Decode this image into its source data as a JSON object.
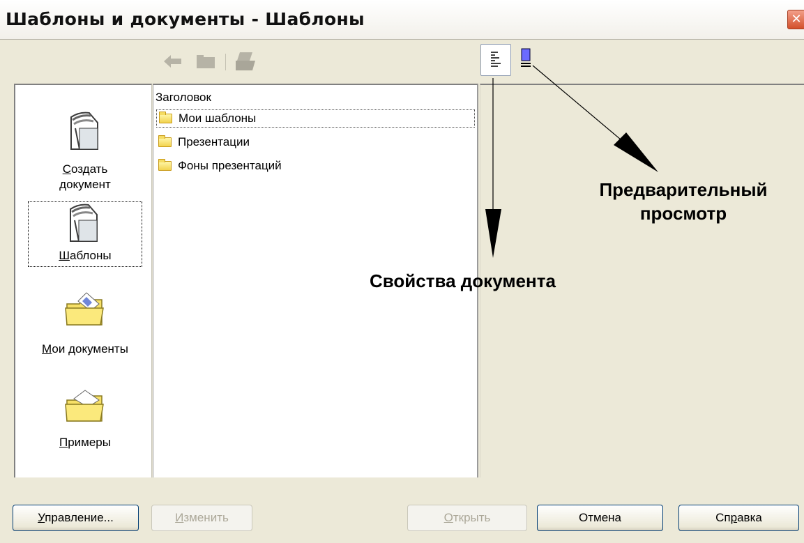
{
  "window": {
    "title": "Шаблоны и документы - Шаблоны",
    "close_glyph": "✕"
  },
  "toolbar": {
    "icons": [
      "back-arrow-icon",
      "folder-up-icon",
      "print-icon"
    ],
    "view_toggles": [
      "document-properties-icon",
      "preview-icon"
    ]
  },
  "categories": [
    {
      "label_first": "С",
      "label_rest": "оздать",
      "label_line2": "документ",
      "icon": "create-document-icon"
    },
    {
      "label_first": "Ш",
      "label_rest": "аблоны",
      "icon": "templates-icon",
      "selected": true
    },
    {
      "label_first": "М",
      "label_rest": "ои документы",
      "icon": "my-documents-folder-icon"
    },
    {
      "label_first": "П",
      "label_rest": "римеры",
      "icon": "samples-folder-icon"
    }
  ],
  "list": {
    "header": "Заголовок",
    "items": [
      "Мои шаблоны",
      "Презентации",
      "Фоны презентаций"
    ]
  },
  "annotations": {
    "preview_line1": "Предварительный",
    "preview_line2": "просмотр",
    "properties": "Свойства документа"
  },
  "buttons": {
    "manage": {
      "first": "У",
      "rest": "правление..."
    },
    "edit": {
      "first": "И",
      "rest": "зменить"
    },
    "open": {
      "first": "О",
      "rest": "ткрыть"
    },
    "cancel": "Отмена",
    "help": {
      "pre": "Сп",
      "mid": "р",
      "post": "авка"
    }
  },
  "colors": {
    "close_button": "#d3502b",
    "folder_yellow": "#f2d34f",
    "preview_blue": "#6b6bff"
  }
}
